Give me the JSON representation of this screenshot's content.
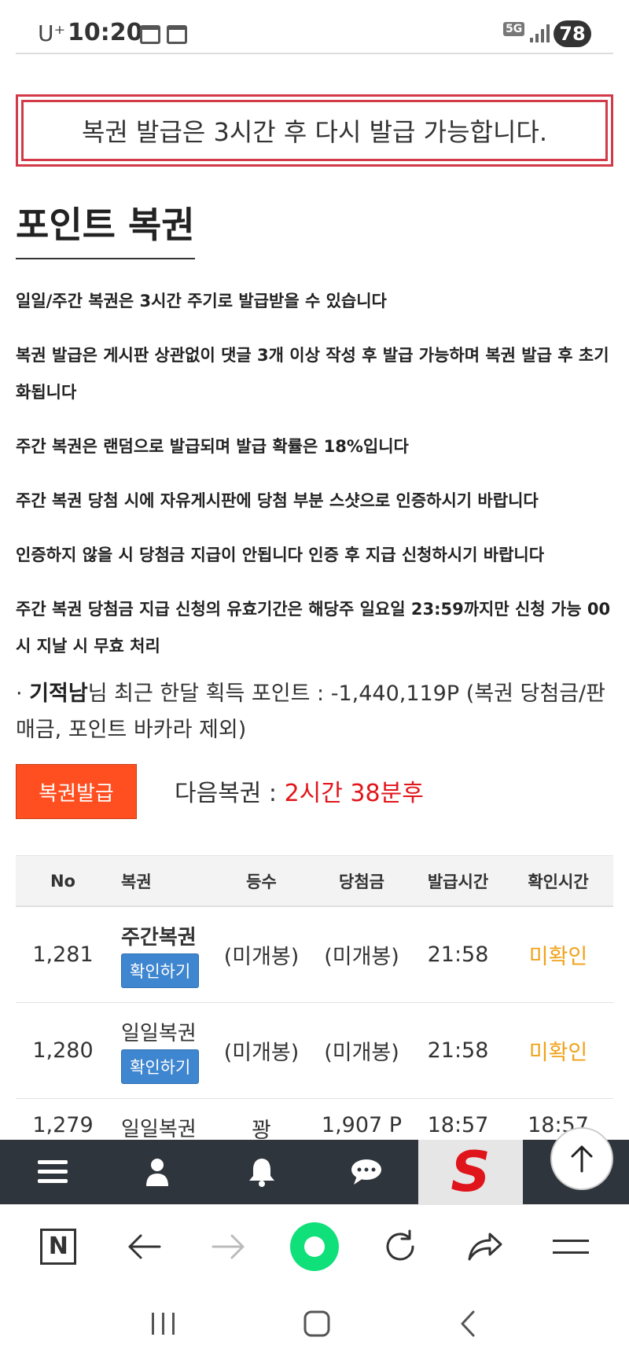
{
  "status": {
    "carrier": "U⁺",
    "time": "10:20",
    "network": "5G",
    "battery": "78"
  },
  "alert": {
    "message": "복권 발급은 3시간 후 다시 발급 가능합니다."
  },
  "page": {
    "title": "포인트 복권"
  },
  "notices": [
    "일일/주간 복권은 3시간 주기로 발급받을 수 있습니다",
    "복권 발급은 게시판 상관없이 댓글 3개 이상 작성 후 발급 가능하며 복권 발급 후 초기화됩니다",
    "주간 복권은 랜덤으로 발급되며 발급 확률은 18%입니다",
    "주간 복권 당첨 시에 자유게시판에 당첨 부분 스샷으로 인증하시기 바랍니다",
    "인증하지 않을 시 당첨금 지급이 안됩니다 인증 후 지급 신청하시기 바랍니다",
    "주간 복권 당첨금 지급 신청의 유효기간은 해당주 일요일 23:59까지만 신청 가능 00시 지날 시 무효 처리"
  ],
  "points": {
    "bullet": "·",
    "username": "기적남",
    "text": "님 최근 한달 획득 포인트 : -1,440,119P (복권 당첨금/판매금, 포인트 바카라 제외)"
  },
  "issue": {
    "button_label": "복권발급",
    "next_label": "다음복권 : ",
    "next_value": "2시간 38분후"
  },
  "table": {
    "headers": [
      "No",
      "복권",
      "등수",
      "당첨금",
      "발급시간",
      "확인시간"
    ],
    "rows": [
      {
        "no": "1,281",
        "ticket": "주간복권",
        "check": "확인하기",
        "rank": "(미개봉)",
        "prize": "(미개봉)",
        "issued": "21:58",
        "checked": "미확인"
      },
      {
        "no": "1,280",
        "ticket": "일일복권",
        "check": "확인하기",
        "rank": "(미개봉)",
        "prize": "(미개봉)",
        "issued": "21:58",
        "checked": "미확인"
      },
      {
        "no": "1,279",
        "ticket": "일일복권",
        "rank": "꽝",
        "prize": "1,907 P",
        "issued": "18:57",
        "checked": "18:57"
      }
    ]
  },
  "sitenav": {
    "logo": "S"
  },
  "browser": {
    "n_label": "N"
  }
}
